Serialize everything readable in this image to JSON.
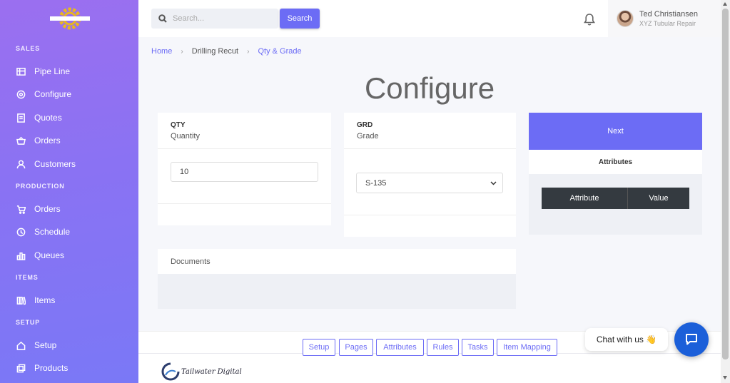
{
  "sidebar": {
    "sections": [
      {
        "label": "SALES",
        "items": [
          {
            "label": "Pipe Line",
            "icon": "table-icon"
          },
          {
            "label": "Configure",
            "icon": "gear-icon"
          },
          {
            "label": "Quotes",
            "icon": "document-icon"
          },
          {
            "label": "Orders",
            "icon": "basket-icon"
          },
          {
            "label": "Customers",
            "icon": "user-icon"
          }
        ]
      },
      {
        "label": "PRODUCTION",
        "items": [
          {
            "label": "Orders",
            "icon": "cart-icon"
          },
          {
            "label": "Schedule",
            "icon": "clock-icon"
          },
          {
            "label": "Queues",
            "icon": "bar-chart-icon"
          }
        ]
      },
      {
        "label": "ITEMS",
        "items": [
          {
            "label": "Items",
            "icon": "books-icon"
          }
        ]
      },
      {
        "label": "SETUP",
        "items": [
          {
            "label": "Setup",
            "icon": "home-icon"
          },
          {
            "label": "Products",
            "icon": "copy-icon"
          }
        ]
      }
    ]
  },
  "header": {
    "search_placeholder": "Search...",
    "search_button": "Search",
    "user_name": "Ted Christiansen",
    "user_org": "XYZ Tubular Repair"
  },
  "breadcrumb": {
    "home": "Home",
    "middle": "Drilling Recut",
    "current": "Qty & Grade"
  },
  "page_title": "Configure",
  "qty_card": {
    "title": "QTY",
    "subtitle": "Quantity",
    "value": "10"
  },
  "grd_card": {
    "title": "GRD",
    "subtitle": "Grade",
    "selected": "S-135"
  },
  "next_card": {
    "button": "Next",
    "heading": "Attributes",
    "col_attribute": "Attribute",
    "col_value": "Value"
  },
  "documents": {
    "title": "Documents"
  },
  "footer": {
    "buttons": [
      "Setup",
      "Pages",
      "Attributes",
      "Rules",
      "Tasks",
      "Item Mapping"
    ],
    "brand": "Tailwater Digital"
  },
  "chat": {
    "text": "Chat with us 👋"
  },
  "colors": {
    "accent": "#6c6cf5",
    "sidebar_top": "#9b6ff0",
    "sidebar_bottom": "#7a78f6",
    "chat": "#1b5fd9"
  }
}
